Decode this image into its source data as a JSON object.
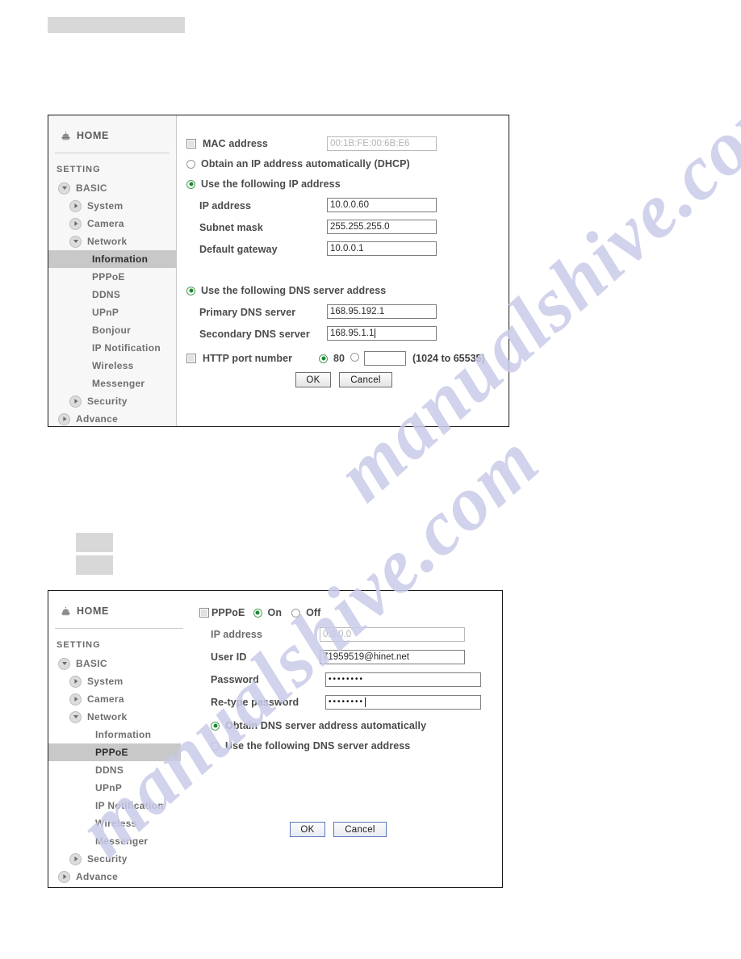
{
  "watermark": {
    "line1": "manualshive.com",
    "line2": "manualshive.com"
  },
  "panels": [
    {
      "id": "information",
      "sidebar": {
        "home_label": "HOME",
        "home_icon": "home-dome-icon",
        "section_label": "SETTING",
        "items": [
          {
            "label": "BASIC",
            "level": 1,
            "toggle": "down",
            "selected": false
          },
          {
            "label": "System",
            "level": 2,
            "toggle": "right",
            "selected": false
          },
          {
            "label": "Camera",
            "level": 2,
            "toggle": "right",
            "selected": false
          },
          {
            "label": "Network",
            "level": 2,
            "toggle": "down",
            "selected": false
          },
          {
            "label": "Information",
            "level": 3,
            "toggle": "none",
            "selected": true
          },
          {
            "label": "PPPoE",
            "level": 3,
            "toggle": "none",
            "selected": false
          },
          {
            "label": "DDNS",
            "level": 3,
            "toggle": "none",
            "selected": false
          },
          {
            "label": "UPnP",
            "level": 3,
            "toggle": "none",
            "selected": false
          },
          {
            "label": "Bonjour",
            "level": 3,
            "toggle": "none",
            "selected": false
          },
          {
            "label": "IP Notification",
            "level": 3,
            "toggle": "none",
            "selected": false
          },
          {
            "label": "Wireless",
            "level": 3,
            "toggle": "none",
            "selected": false
          },
          {
            "label": "Messenger",
            "level": 3,
            "toggle": "none",
            "selected": false
          },
          {
            "label": "Security",
            "level": 2,
            "toggle": "right",
            "selected": false
          },
          {
            "label": "Advance",
            "level": 1,
            "toggle": "right",
            "selected": false
          }
        ]
      },
      "form": {
        "mac_label": "MAC address",
        "mac_value": "00:1B:FE:00:6B:E6",
        "dhcp_label": "Obtain an IP address automatically (DHCP)",
        "static_ip_label": "Use the following IP address",
        "ip_label": "IP address",
        "ip_value": "10.0.0.60",
        "subnet_label": "Subnet mask",
        "subnet_value": "255.255.255.0",
        "gateway_label": "Default gateway",
        "gateway_value": "10.0.0.1",
        "dns_static_label": "Use the following DNS server address",
        "dns_primary_label": "Primary DNS server",
        "dns_primary_value": "168.95.192.1",
        "dns_secondary_label": "Secondary DNS server",
        "dns_secondary_value": "168.95.1.1",
        "http_port_label": "HTTP port number",
        "http_port_default": "80",
        "http_port_custom_value": "",
        "http_port_range": "(1024 to 65535)",
        "ok_label": "OK",
        "cancel_label": "Cancel"
      }
    },
    {
      "id": "pppoe",
      "sidebar": {
        "home_label": "HOME",
        "home_icon": "home-dome-icon",
        "section_label": "SETTING",
        "items": [
          {
            "label": "BASIC",
            "level": 1,
            "toggle": "down",
            "selected": false
          },
          {
            "label": "System",
            "level": 2,
            "toggle": "right",
            "selected": false
          },
          {
            "label": "Camera",
            "level": 2,
            "toggle": "right",
            "selected": false
          },
          {
            "label": "Network",
            "level": 2,
            "toggle": "down",
            "selected": false
          },
          {
            "label": "Information",
            "level": 3,
            "toggle": "none",
            "selected": false
          },
          {
            "label": "PPPoE",
            "level": 3,
            "toggle": "none",
            "selected": true
          },
          {
            "label": "DDNS",
            "level": 3,
            "toggle": "none",
            "selected": false
          },
          {
            "label": "UPnP",
            "level": 3,
            "toggle": "none",
            "selected": false
          },
          {
            "label": "IP Notification",
            "level": 3,
            "toggle": "none",
            "selected": false
          },
          {
            "label": "Wireless",
            "level": 3,
            "toggle": "none",
            "selected": false
          },
          {
            "label": "Messenger",
            "level": 3,
            "toggle": "none",
            "selected": false
          },
          {
            "label": "Security",
            "level": 2,
            "toggle": "right",
            "selected": false
          },
          {
            "label": "Advance",
            "level": 1,
            "toggle": "right",
            "selected": false
          }
        ]
      },
      "form": {
        "pppoe_label": "PPPoE",
        "on_label": "On",
        "off_label": "Off",
        "ip_label": "IP address",
        "ip_value": "0.0.0.0",
        "user_id_label": "User ID",
        "user_id_value": "71959519@hinet.net",
        "password_label": "Password",
        "password_value": "••••••••",
        "retype_label": "Re-type password",
        "retype_value": "••••••••",
        "dns_auto_label": "Obtain DNS server address automatically",
        "dns_static_label": "Use the following DNS server address",
        "ok_label": "OK",
        "cancel_label": "Cancel"
      }
    }
  ]
}
